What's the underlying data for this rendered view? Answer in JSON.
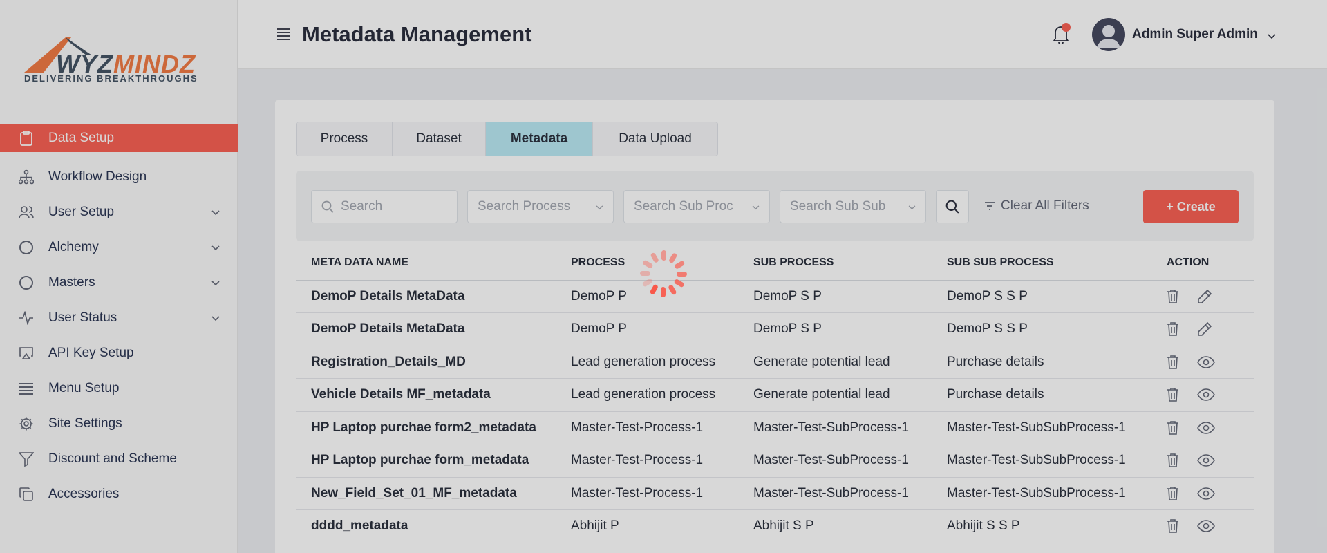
{
  "brand": {
    "name_part1": "WYZ",
    "name_part2": "MINDZ",
    "tagline": "DELIVERING  BREAKTHROUGHS"
  },
  "sidebar": {
    "items": [
      {
        "label": "Data Setup",
        "icon": "clipboard-icon",
        "active": true,
        "has_children": false
      },
      {
        "label": "Workflow Design",
        "icon": "sitemap-icon",
        "active": false,
        "has_children": false
      },
      {
        "label": "User Setup",
        "icon": "users-icon",
        "active": false,
        "has_children": true
      },
      {
        "label": "Alchemy",
        "icon": "circle-icon",
        "active": false,
        "has_children": true
      },
      {
        "label": "Masters",
        "icon": "circle-icon",
        "active": false,
        "has_children": true
      },
      {
        "label": "User Status",
        "icon": "activity-icon",
        "active": false,
        "has_children": true
      },
      {
        "label": "API Key Setup",
        "icon": "airplay-icon",
        "active": false,
        "has_children": false
      },
      {
        "label": "Menu Setup",
        "icon": "list-icon",
        "active": false,
        "has_children": false
      },
      {
        "label": "Site Settings",
        "icon": "gear-icon",
        "active": false,
        "has_children": false
      },
      {
        "label": "Discount and Scheme",
        "icon": "filter-icon",
        "active": false,
        "has_children": false
      },
      {
        "label": "Accessories",
        "icon": "copy-icon",
        "active": false,
        "has_children": false
      }
    ]
  },
  "header": {
    "title": "Metadata Management",
    "user_name": "Admin Super Admin",
    "has_notification": true
  },
  "tabs": [
    {
      "label": "Process",
      "active": false
    },
    {
      "label": "Dataset",
      "active": false
    },
    {
      "label": "Metadata",
      "active": true
    },
    {
      "label": "Data Upload",
      "active": false
    }
  ],
  "filters": {
    "search_placeholder": "Search",
    "process_placeholder": "Search Process",
    "sub_process_placeholder": "Search Sub Proc",
    "sub_sub_process_placeholder": "Search Sub Sub",
    "clear_all": "Clear All Filters",
    "create": "+ Create"
  },
  "table": {
    "columns": [
      "META DATA NAME",
      "PROCESS",
      "SUB PROCESS",
      "SUB SUB PROCESS",
      "ACTION"
    ],
    "rows": [
      {
        "name": "DemoP Details MetaData",
        "process": "DemoP P",
        "sub_process": "DemoP S P",
        "sub_sub_process": "DemoP S S P",
        "actions": [
          "trash-icon",
          "pencil-icon"
        ]
      },
      {
        "name": "DemoP Details MetaData",
        "process": "DemoP P",
        "sub_process": "DemoP S P",
        "sub_sub_process": "DemoP S S P",
        "actions": [
          "trash-icon",
          "pencil-icon"
        ]
      },
      {
        "name": "Registration_Details_MD",
        "process": "Lead generation process",
        "sub_process": "Generate potential lead",
        "sub_sub_process": "Purchase details",
        "actions": [
          "trash-icon",
          "eye-icon"
        ]
      },
      {
        "name": "Vehicle Details MF_metadata",
        "process": "Lead generation process",
        "sub_process": "Generate potential lead",
        "sub_sub_process": "Purchase details",
        "actions": [
          "trash-icon",
          "eye-icon"
        ]
      },
      {
        "name": "HP Laptop purchae form2_metadata",
        "process": "Master-Test-Process-1",
        "sub_process": "Master-Test-SubProcess-1",
        "sub_sub_process": "Master-Test-SubSubProcess-1",
        "actions": [
          "trash-icon",
          "eye-icon"
        ]
      },
      {
        "name": "HP Laptop purchae form_metadata",
        "process": "Master-Test-Process-1",
        "sub_process": "Master-Test-SubProcess-1",
        "sub_sub_process": "Master-Test-SubSubProcess-1",
        "actions": [
          "trash-icon",
          "eye-icon"
        ]
      },
      {
        "name": "New_Field_Set_01_MF_metadata",
        "process": "Master-Test-Process-1",
        "sub_process": "Master-Test-SubProcess-1",
        "sub_sub_process": "Master-Test-SubSubProcess-1",
        "actions": [
          "trash-icon",
          "eye-icon"
        ]
      },
      {
        "name": "dddd_metadata",
        "process": "Abhijit P",
        "sub_process": "Abhijit S P",
        "sub_sub_process": "Abhijit S S P",
        "actions": [
          "trash-icon",
          "eye-icon"
        ]
      }
    ]
  },
  "colors": {
    "accent": "#f9584a",
    "active_tab": "#b7e9f4",
    "overlay": "rgba(60,60,60,0.20)"
  },
  "loading": true
}
